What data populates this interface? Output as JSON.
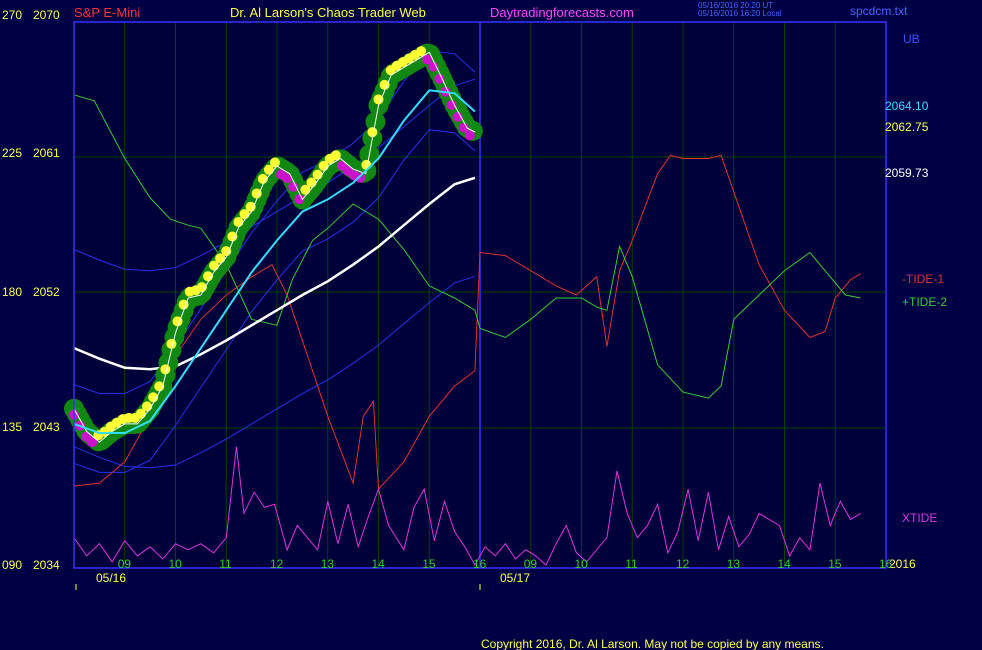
{
  "header": {
    "instrument": "S&P E-Mini",
    "author": "Dr. Al Larson's Chaos Trader Web",
    "site": "Daytradingforecasts.com",
    "ts_line1": "05/16/2016 20:20 UT",
    "ts_line2": "05/16/2016 16:20 Local",
    "file": "spcdcm.txt"
  },
  "colors": {
    "background": "#000044",
    "plot_bg": "#00003a",
    "grid": "#004400",
    "frame": "#3333ff",
    "price": "#ffffff",
    "cyan": "#33ddff",
    "white_ma": "#ffffff",
    "blue_band": "#2233ee",
    "tide1": "#e03030",
    "tide2": "#33cc33",
    "xtide": "#dd33dd",
    "dot_green": "#118811",
    "dot_yellow": "#ffff33",
    "dot_magenta": "#cc11cc",
    "instrument_text": "#ff3333",
    "author_text": "#ffff44",
    "site_text": "#ff44ff",
    "axis_text": "#ffff44",
    "hour_text": "#33cc33"
  },
  "left_axis": {
    "deg_labels": [
      "270",
      "225",
      "180",
      "135",
      "090"
    ],
    "price_labels": [
      "2070",
      "2061",
      "2052",
      "2043",
      "2034"
    ]
  },
  "right_labels": {
    "ub": "UB",
    "p1": "2064.10",
    "p2": "2062.75",
    "p3": "2059.73",
    "tide1": "-TIDE-1",
    "tide2": "+TIDE-2",
    "xtide": "XTIDE",
    "year": "2016"
  },
  "x_axis": {
    "hours": [
      "09",
      "10",
      "11",
      "12",
      "13",
      "14",
      "15",
      "16",
      "09",
      "10",
      "11",
      "12",
      "13",
      "14",
      "15",
      "16"
    ],
    "day1": "05/16",
    "day2": "05/17"
  },
  "copyright": "Copyright 2016, Dr. Al Larson. May not be copied by any means.",
  "chart_data": {
    "type": "line",
    "title": "S&P E-Mini",
    "price_axis_range": [
      2034,
      2070
    ],
    "degree_axis_range": [
      90,
      270
    ],
    "x_unit": "hour of day (05/16 then 05/17)",
    "x_range": [
      8,
      24
    ],
    "series": [
      {
        "name": "price",
        "points": [
          [
            8.0,
            2044.5
          ],
          [
            8.25,
            2043.0
          ],
          [
            8.5,
            2042.3
          ],
          [
            8.75,
            2043.0
          ],
          [
            9.0,
            2043.5
          ],
          [
            9.25,
            2043.5
          ],
          [
            9.5,
            2044.5
          ],
          [
            9.75,
            2046.0
          ],
          [
            10.0,
            2049.5
          ],
          [
            10.25,
            2051.8
          ],
          [
            10.5,
            2052.0
          ],
          [
            10.75,
            2053.5
          ],
          [
            11.0,
            2054.5
          ],
          [
            11.25,
            2056.5
          ],
          [
            11.5,
            2057.5
          ],
          [
            11.75,
            2059.5
          ],
          [
            12.0,
            2060.5
          ],
          [
            12.25,
            2060.0
          ],
          [
            12.5,
            2058.3
          ],
          [
            12.75,
            2059.3
          ],
          [
            13.0,
            2060.5
          ],
          [
            13.25,
            2061.0
          ],
          [
            13.5,
            2060.3
          ],
          [
            13.75,
            2060.0
          ],
          [
            14.0,
            2064.5
          ],
          [
            14.25,
            2066.5
          ],
          [
            14.5,
            2067.0
          ],
          [
            14.75,
            2067.5
          ],
          [
            15.0,
            2068.0
          ],
          [
            15.25,
            2066.3
          ],
          [
            15.5,
            2064.5
          ],
          [
            15.75,
            2063.0
          ],
          [
            15.9,
            2062.75
          ]
        ]
      },
      {
        "name": "cyan average",
        "points": [
          [
            8.0,
            2043.5
          ],
          [
            8.5,
            2042.9
          ],
          [
            9.0,
            2042.9
          ],
          [
            9.5,
            2043.7
          ],
          [
            10.0,
            2046.0
          ],
          [
            10.5,
            2048.5
          ],
          [
            11.0,
            2051.0
          ],
          [
            11.5,
            2053.5
          ],
          [
            12.0,
            2055.6
          ],
          [
            12.5,
            2057.5
          ],
          [
            13.0,
            2058.3
          ],
          [
            13.5,
            2059.4
          ],
          [
            14.0,
            2061.0
          ],
          [
            14.5,
            2063.5
          ],
          [
            15.0,
            2065.5
          ],
          [
            15.5,
            2065.3
          ],
          [
            15.9,
            2064.1
          ]
        ]
      },
      {
        "name": "white average",
        "points": [
          [
            8.0,
            2048.5
          ],
          [
            8.5,
            2047.8
          ],
          [
            9.0,
            2047.2
          ],
          [
            9.5,
            2047.1
          ],
          [
            10.0,
            2047.3
          ],
          [
            10.5,
            2048.1
          ],
          [
            11.0,
            2049.0
          ],
          [
            11.5,
            2050.0
          ],
          [
            12.0,
            2051.0
          ],
          [
            12.5,
            2052.0
          ],
          [
            13.0,
            2052.9
          ],
          [
            13.5,
            2054.0
          ],
          [
            14.0,
            2055.2
          ],
          [
            14.5,
            2056.6
          ],
          [
            15.0,
            2058.0
          ],
          [
            15.5,
            2059.3
          ],
          [
            15.9,
            2059.73
          ]
        ]
      },
      {
        "name": "-TIDE-1",
        "points": [
          [
            8.0,
            117
          ],
          [
            8.5,
            118
          ],
          [
            9.0,
            125
          ],
          [
            9.5,
            140
          ],
          [
            10.0,
            160
          ],
          [
            10.5,
            172
          ],
          [
            11.0,
            180
          ],
          [
            11.5,
            186
          ],
          [
            11.9,
            190
          ],
          [
            12.2,
            180
          ],
          [
            12.5,
            165
          ],
          [
            13.0,
            140
          ],
          [
            13.5,
            118
          ],
          [
            13.7,
            140
          ],
          [
            13.9,
            145
          ],
          [
            14.0,
            116
          ],
          [
            14.5,
            125
          ],
          [
            15.0,
            140
          ],
          [
            15.5,
            150
          ],
          [
            15.9,
            155
          ],
          [
            16.0,
            194
          ],
          [
            16.5,
            193
          ],
          [
            17.0,
            188
          ],
          [
            17.5,
            183
          ],
          [
            17.9,
            180
          ],
          [
            18.3,
            186
          ],
          [
            18.5,
            163
          ],
          [
            18.75,
            188
          ],
          [
            19.0,
            198
          ],
          [
            19.5,
            220
          ],
          [
            19.75,
            226
          ],
          [
            20.0,
            225
          ],
          [
            20.5,
            225
          ],
          [
            20.75,
            226
          ],
          [
            21.0,
            214
          ],
          [
            21.5,
            190
          ],
          [
            22.0,
            175
          ],
          [
            22.5,
            166
          ],
          [
            22.8,
            168
          ],
          [
            23.0,
            179
          ],
          [
            23.3,
            185
          ],
          [
            23.5,
            187
          ]
        ]
      },
      {
        "name": "+TIDE-2",
        "points": [
          [
            8.0,
            246
          ],
          [
            8.4,
            244
          ],
          [
            9.0,
            225
          ],
          [
            9.5,
            212
          ],
          [
            9.9,
            205
          ],
          [
            10.25,
            203
          ],
          [
            10.5,
            202
          ],
          [
            11.0,
            190
          ],
          [
            11.5,
            172
          ],
          [
            12.0,
            170
          ],
          [
            12.3,
            185
          ],
          [
            12.7,
            198
          ],
          [
            13.0,
            202
          ],
          [
            13.5,
            210
          ],
          [
            14.0,
            205
          ],
          [
            14.5,
            195
          ],
          [
            15.0,
            183
          ],
          [
            15.5,
            179
          ],
          [
            15.9,
            175
          ],
          [
            16.0,
            169
          ],
          [
            16.5,
            166
          ],
          [
            17.0,
            172
          ],
          [
            17.5,
            179
          ],
          [
            18.0,
            179
          ],
          [
            18.3,
            176
          ],
          [
            18.5,
            175
          ],
          [
            18.75,
            196
          ],
          [
            19.0,
            186
          ],
          [
            19.5,
            157
          ],
          [
            20.0,
            148
          ],
          [
            20.5,
            146
          ],
          [
            20.75,
            150
          ],
          [
            21.0,
            172
          ],
          [
            21.5,
            180
          ],
          [
            22.0,
            188
          ],
          [
            22.5,
            194
          ],
          [
            22.8,
            188
          ],
          [
            23.2,
            180
          ],
          [
            23.5,
            179
          ]
        ]
      },
      {
        "name": "XTIDE",
        "points": [
          [
            8.0,
            100
          ],
          [
            8.25,
            94
          ],
          [
            8.5,
            98
          ],
          [
            8.75,
            92
          ],
          [
            9.0,
            99
          ],
          [
            9.25,
            94
          ],
          [
            9.5,
            97
          ],
          [
            9.75,
            93
          ],
          [
            10.0,
            98
          ],
          [
            10.25,
            96
          ],
          [
            10.5,
            98
          ],
          [
            10.75,
            95
          ],
          [
            11.0,
            100
          ],
          [
            11.2,
            130
          ],
          [
            11.35,
            108
          ],
          [
            11.55,
            115
          ],
          [
            11.75,
            110
          ],
          [
            11.95,
            111
          ],
          [
            12.2,
            96
          ],
          [
            12.4,
            104
          ],
          [
            12.6,
            100
          ],
          [
            12.8,
            96
          ],
          [
            13.0,
            112
          ],
          [
            13.2,
            98
          ],
          [
            13.4,
            111
          ],
          [
            13.6,
            97
          ],
          [
            13.8,
            107
          ],
          [
            14.0,
            116
          ],
          [
            14.2,
            104
          ],
          [
            14.5,
            96
          ],
          [
            14.7,
            110
          ],
          [
            14.9,
            116
          ],
          [
            15.1,
            99
          ],
          [
            15.3,
            112
          ],
          [
            15.5,
            102
          ],
          [
            15.7,
            97
          ],
          [
            15.9,
            91
          ],
          [
            16.1,
            97
          ],
          [
            16.3,
            94
          ],
          [
            16.5,
            98
          ],
          [
            16.7,
            93
          ],
          [
            16.9,
            96
          ],
          [
            17.1,
            94
          ],
          [
            17.3,
            91
          ],
          [
            17.5,
            98
          ],
          [
            17.7,
            104
          ],
          [
            17.9,
            95
          ],
          [
            18.1,
            92
          ],
          [
            18.3,
            96
          ],
          [
            18.5,
            100
          ],
          [
            18.7,
            122
          ],
          [
            18.9,
            108
          ],
          [
            19.1,
            100
          ],
          [
            19.3,
            104
          ],
          [
            19.5,
            111
          ],
          [
            19.7,
            95
          ],
          [
            19.9,
            102
          ],
          [
            20.1,
            116
          ],
          [
            20.3,
            99
          ],
          [
            20.5,
            115
          ],
          [
            20.7,
            96
          ],
          [
            20.9,
            107
          ],
          [
            21.1,
            97
          ],
          [
            21.3,
            101
          ],
          [
            21.5,
            108
          ],
          [
            21.7,
            106
          ],
          [
            21.9,
            104
          ],
          [
            22.1,
            94
          ],
          [
            22.3,
            100
          ],
          [
            22.5,
            96
          ],
          [
            22.7,
            118
          ],
          [
            22.9,
            104
          ],
          [
            23.1,
            112
          ],
          [
            23.3,
            106
          ],
          [
            23.5,
            108
          ]
        ]
      }
    ]
  }
}
